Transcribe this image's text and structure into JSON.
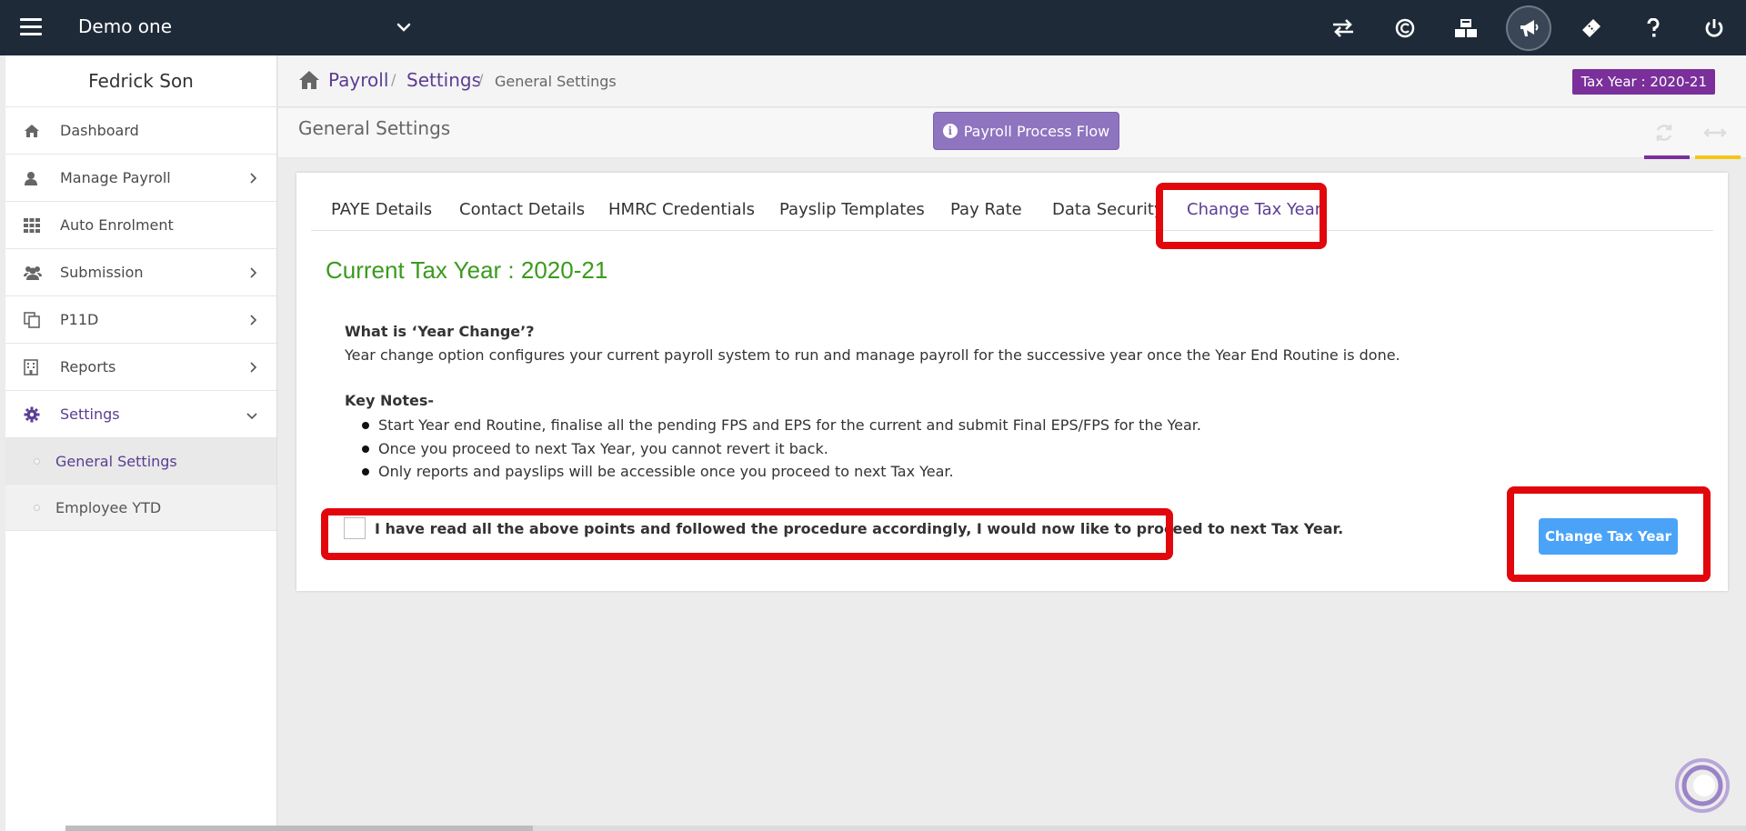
{
  "topbar": {
    "company_name": "Demo one",
    "icons": [
      "swap-icon",
      "c-logo-icon",
      "boxes-icon",
      "megaphone-icon",
      "ticket-icon",
      "help-icon",
      "power-icon"
    ]
  },
  "sidebar": {
    "user_name": "Fedrick Son",
    "items": [
      {
        "label": "Dashboard",
        "icon": "home-icon"
      },
      {
        "label": "Manage Payroll",
        "icon": "user-icon"
      },
      {
        "label": "Auto Enrolment",
        "icon": "grid-icon"
      },
      {
        "label": "Submission",
        "icon": "users-icon"
      },
      {
        "label": "P11D",
        "icon": "copy-icon"
      },
      {
        "label": "Reports",
        "icon": "building-icon"
      },
      {
        "label": "Settings",
        "icon": "gear-icon"
      }
    ],
    "sub_items": [
      {
        "label": "General Settings"
      },
      {
        "label": "Employee YTD"
      }
    ]
  },
  "breadcrumb": {
    "items": [
      "Payroll",
      "Settings"
    ],
    "separator": "/",
    "current": "General Settings"
  },
  "tax_year_badge": "Tax Year : 2020-21",
  "page_header": {
    "title": "General Settings",
    "flow_button": "Payroll Process Flow"
  },
  "tabs": [
    {
      "label": "PAYE Details"
    },
    {
      "label": "Contact Details"
    },
    {
      "label": "HMRC Credentials"
    },
    {
      "label": "Payslip Templates"
    },
    {
      "label": "Pay Rate"
    },
    {
      "label": "Data Security"
    },
    {
      "label": "Change Tax Year"
    }
  ],
  "content": {
    "current_year": "Current Tax Year : 2020-21",
    "question_title": "What is ‘Year Change’?",
    "question_desc": "Year change option configures your current payroll system to run and manage payroll for the successive year once the Year End Routine is done.",
    "key_notes_title": "Key Notes-",
    "key_notes": [
      "Start Year end Routine, finalise all the pending FPS and EPS for the current and submit Final EPS/FPS for the Year.",
      "Once you proceed to next Tax Year, you cannot revert it back.",
      "Only reports and payslips will be accessible once you proceed to next Tax Year."
    ],
    "confirm_text": "I have read all the above points and followed the procedure accordingly, I would now like to proceed to next Tax Year.",
    "change_button": "Change Tax Year"
  },
  "colors": {
    "topbar": "#1e2a38",
    "accent_purple": "#5b3d93",
    "badge_purple": "#7a2f9a",
    "green_heading": "#3a9b1c",
    "primary_blue": "#4aa3f7",
    "highlight_red": "#e1070c"
  }
}
